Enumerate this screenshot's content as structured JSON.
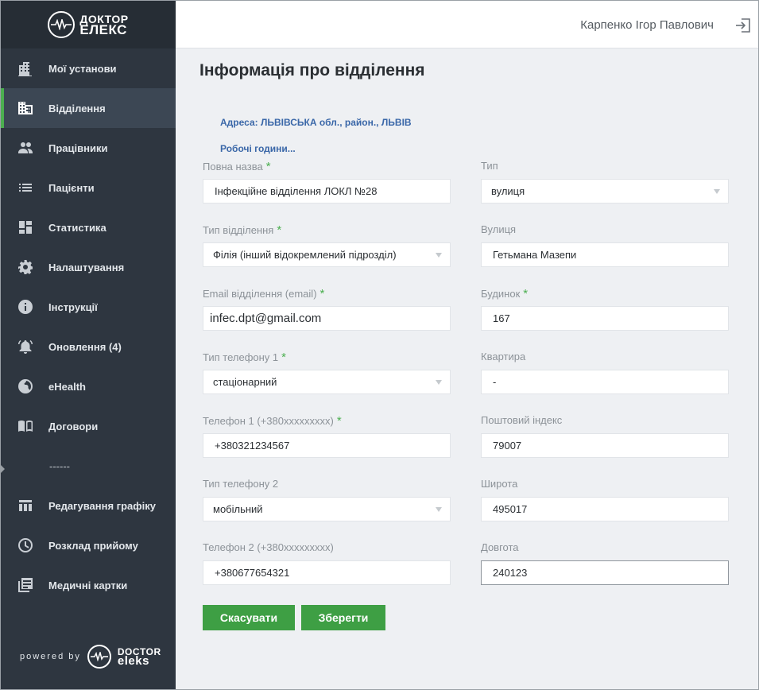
{
  "brand": {
    "logo_line1": "ДОКТОР",
    "logo_line2": "ЕЛЕКС",
    "powered_label": "powered by",
    "powered_line1": "DOCTOR",
    "powered_line2": "eleks"
  },
  "header": {
    "user_name": "Карпенко Ігор Павлович",
    "logout_icon": "logout-icon"
  },
  "sidebar": {
    "items": [
      {
        "label": "Мої установи",
        "icon": "building-icon",
        "active": false
      },
      {
        "label": "Відділення",
        "icon": "department-icon",
        "active": true
      },
      {
        "label": "Працівники",
        "icon": "people-icon",
        "active": false
      },
      {
        "label": "Пацієнти",
        "icon": "list-icon",
        "active": false
      },
      {
        "label": "Статистика",
        "icon": "dashboard-icon",
        "active": false
      },
      {
        "label": "Налаштування",
        "icon": "gear-icon",
        "active": false
      },
      {
        "label": "Інструкції",
        "icon": "info-icon",
        "active": false
      },
      {
        "label": "Оновлення (4)",
        "icon": "bell-icon",
        "active": false
      },
      {
        "label": "eHealth",
        "icon": "globe-icon",
        "active": false
      },
      {
        "label": "Договори",
        "icon": "book-icon",
        "active": false
      }
    ],
    "separator": "------",
    "items2": [
      {
        "label": "Редагування графіку",
        "icon": "table-icon"
      },
      {
        "label": "Розклад прийому",
        "icon": "clock-icon"
      },
      {
        "label": "Медичні картки",
        "icon": "cards-icon"
      }
    ]
  },
  "main": {
    "title": "Інформація про відділення",
    "address": "Адреса: ЛЬВІВСЬКА обл., район., ЛЬВІВ",
    "hours_link": "Робочі години...",
    "required_mark": "*",
    "fields_left": [
      {
        "label": "Повна назва",
        "value": "Інфекційне відділення ЛОКЛ №28",
        "required": true,
        "type": "text"
      },
      {
        "label": "Тип відділення",
        "value": "Філія (інший відокремлений підрозділ)",
        "required": true,
        "type": "select"
      },
      {
        "label": "Email відділення (email)",
        "value": "infec.dpt@gmail.com",
        "required": true,
        "type": "email"
      },
      {
        "label": "Тип телефону 1",
        "value": "стаціонарний",
        "required": true,
        "type": "select"
      },
      {
        "label": "Телефон 1 (+380xxxxxxxxx)",
        "value": "+380321234567",
        "required": true,
        "type": "text"
      },
      {
        "label": "Тип телефону 2",
        "value": "мобільний",
        "required": false,
        "type": "select"
      },
      {
        "label": "Телефон 2 (+380xxxxxxxxx)",
        "value": "+380677654321",
        "required": false,
        "type": "text"
      }
    ],
    "fields_right": [
      {
        "label": "Тип",
        "value": "вулиця",
        "required": false,
        "type": "select"
      },
      {
        "label": "Вулиця",
        "value": "Гетьмана Мазепи",
        "required": false,
        "type": "text"
      },
      {
        "label": "Будинок",
        "value": "167",
        "required": true,
        "type": "text"
      },
      {
        "label": "Квартира",
        "value": "-",
        "required": false,
        "type": "text"
      },
      {
        "label": "Поштовий індекс",
        "value": "79007",
        "required": false,
        "type": "text"
      },
      {
        "label": "Широта",
        "value": "495017",
        "required": false,
        "type": "text"
      },
      {
        "label": "Довгота",
        "value": "240123",
        "required": false,
        "type": "text",
        "focused": true
      }
    ],
    "cancel_label": "Скасувати",
    "save_label": "Зберегти"
  },
  "colors": {
    "sidebar": "#2e3640",
    "accent": "#3e9f44",
    "link": "#3a67a8"
  }
}
